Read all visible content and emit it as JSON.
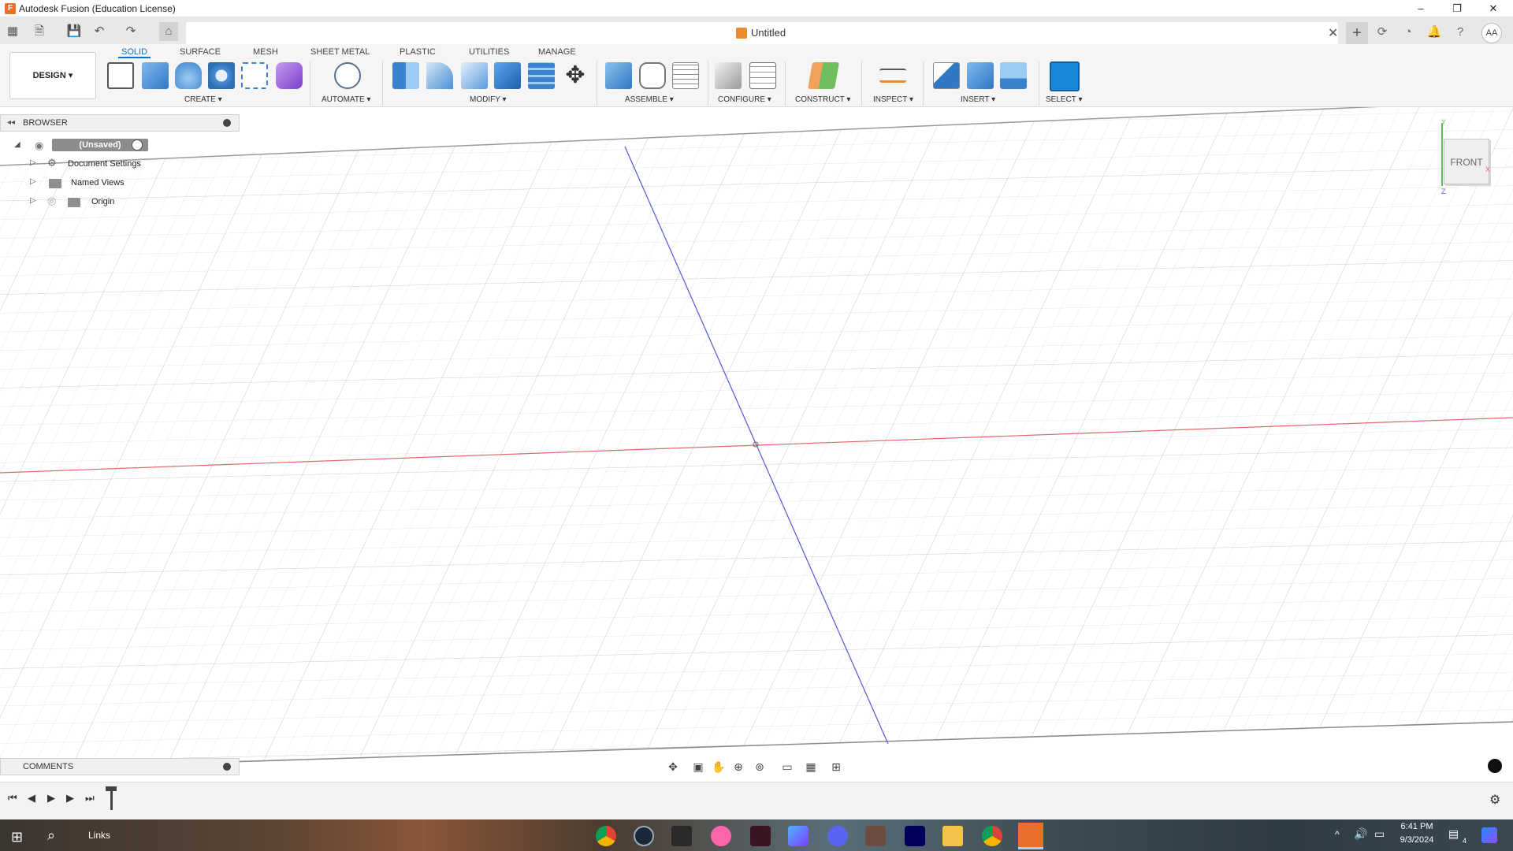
{
  "window": {
    "title": "Autodesk Fusion (Education License)",
    "minimize": "–",
    "restore": "❐",
    "close": "✕"
  },
  "document": {
    "title": "Untitled",
    "close": "✕",
    "new_tab": "+"
  },
  "user": {
    "initials": "AA"
  },
  "ribbon": {
    "tabs": [
      "SOLID",
      "SURFACE",
      "MESH",
      "SHEET METAL",
      "PLASTIC",
      "UTILITIES",
      "MANAGE"
    ],
    "active_tab": "SOLID",
    "workspace": "DESIGN ▾",
    "groups": [
      "CREATE ▾",
      "AUTOMATE ▾",
      "MODIFY ▾",
      "ASSEMBLE ▾",
      "CONFIGURE ▾",
      "CONSTRUCT ▾",
      "INSPECT ▾",
      "INSERT ▾",
      "SELECT ▾"
    ]
  },
  "browser": {
    "title": "BROWSER",
    "root": "(Unsaved)",
    "items": [
      "Document Settings",
      "Named Views",
      "Origin"
    ]
  },
  "viewcube": {
    "face": "FRONT",
    "axis_y": "Y",
    "axis_z": "Z",
    "axis_x": "X"
  },
  "comments": {
    "title": "COMMENTS"
  },
  "taskbar": {
    "links": "Links",
    "time": "6:41 PM",
    "date": "9/3/2024",
    "notification_count": "4"
  },
  "colors": {
    "accent": "#0a73c7",
    "x_axis": "#e06666",
    "z_axis": "#4d5bdb",
    "grid": "#d9d9d9"
  }
}
